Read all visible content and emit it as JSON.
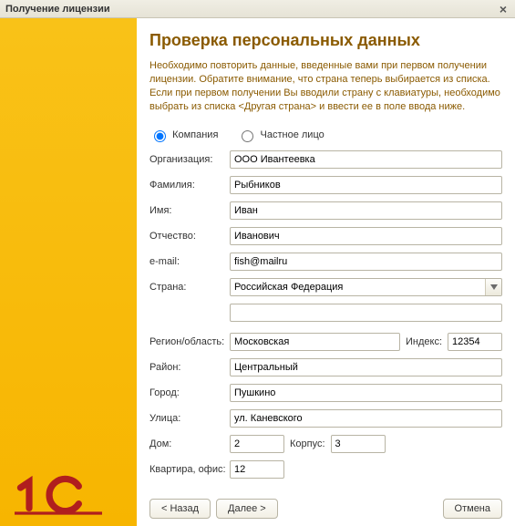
{
  "window": {
    "title": "Получение лицензии"
  },
  "page": {
    "heading": "Проверка персональных данных",
    "intro": "Необходимо повторить данные, введенные вами при первом получении лицензии. Обратите внимание, что страна теперь выбирается из списка. Если при первом получении Вы вводили страну с клавиатуры, необходимо выбрать из списка <Другая страна> и ввести ее в поле ввода ниже."
  },
  "radios": {
    "company": "Компания",
    "private": "Частное лицо"
  },
  "labels": {
    "organization": "Организация:",
    "lastname": "Фамилия:",
    "firstname": "Имя:",
    "patronymic": "Отчество:",
    "email": "e-mail:",
    "country": "Страна:",
    "region": "Регион/область:",
    "index": "Индекс:",
    "district": "Район:",
    "city": "Город:",
    "street": "Улица:",
    "house": "Дом:",
    "building": "Корпус:",
    "apartment": "Квартира, офис:"
  },
  "values": {
    "organization": "ООО Ивантеевка",
    "lastname": "Рыбников",
    "firstname": "Иван",
    "patronymic": "Иванович",
    "email": "fish@mailru",
    "country": "Российская Федерация",
    "country_other": "",
    "region": "Московская",
    "index": "12354",
    "district": "Центральный",
    "city": "Пушкино",
    "street": "ул. Каневского",
    "house": "2",
    "building": "3",
    "apartment": "12"
  },
  "buttons": {
    "back": "< Назад",
    "next": "Далее >",
    "cancel": "Отмена"
  }
}
